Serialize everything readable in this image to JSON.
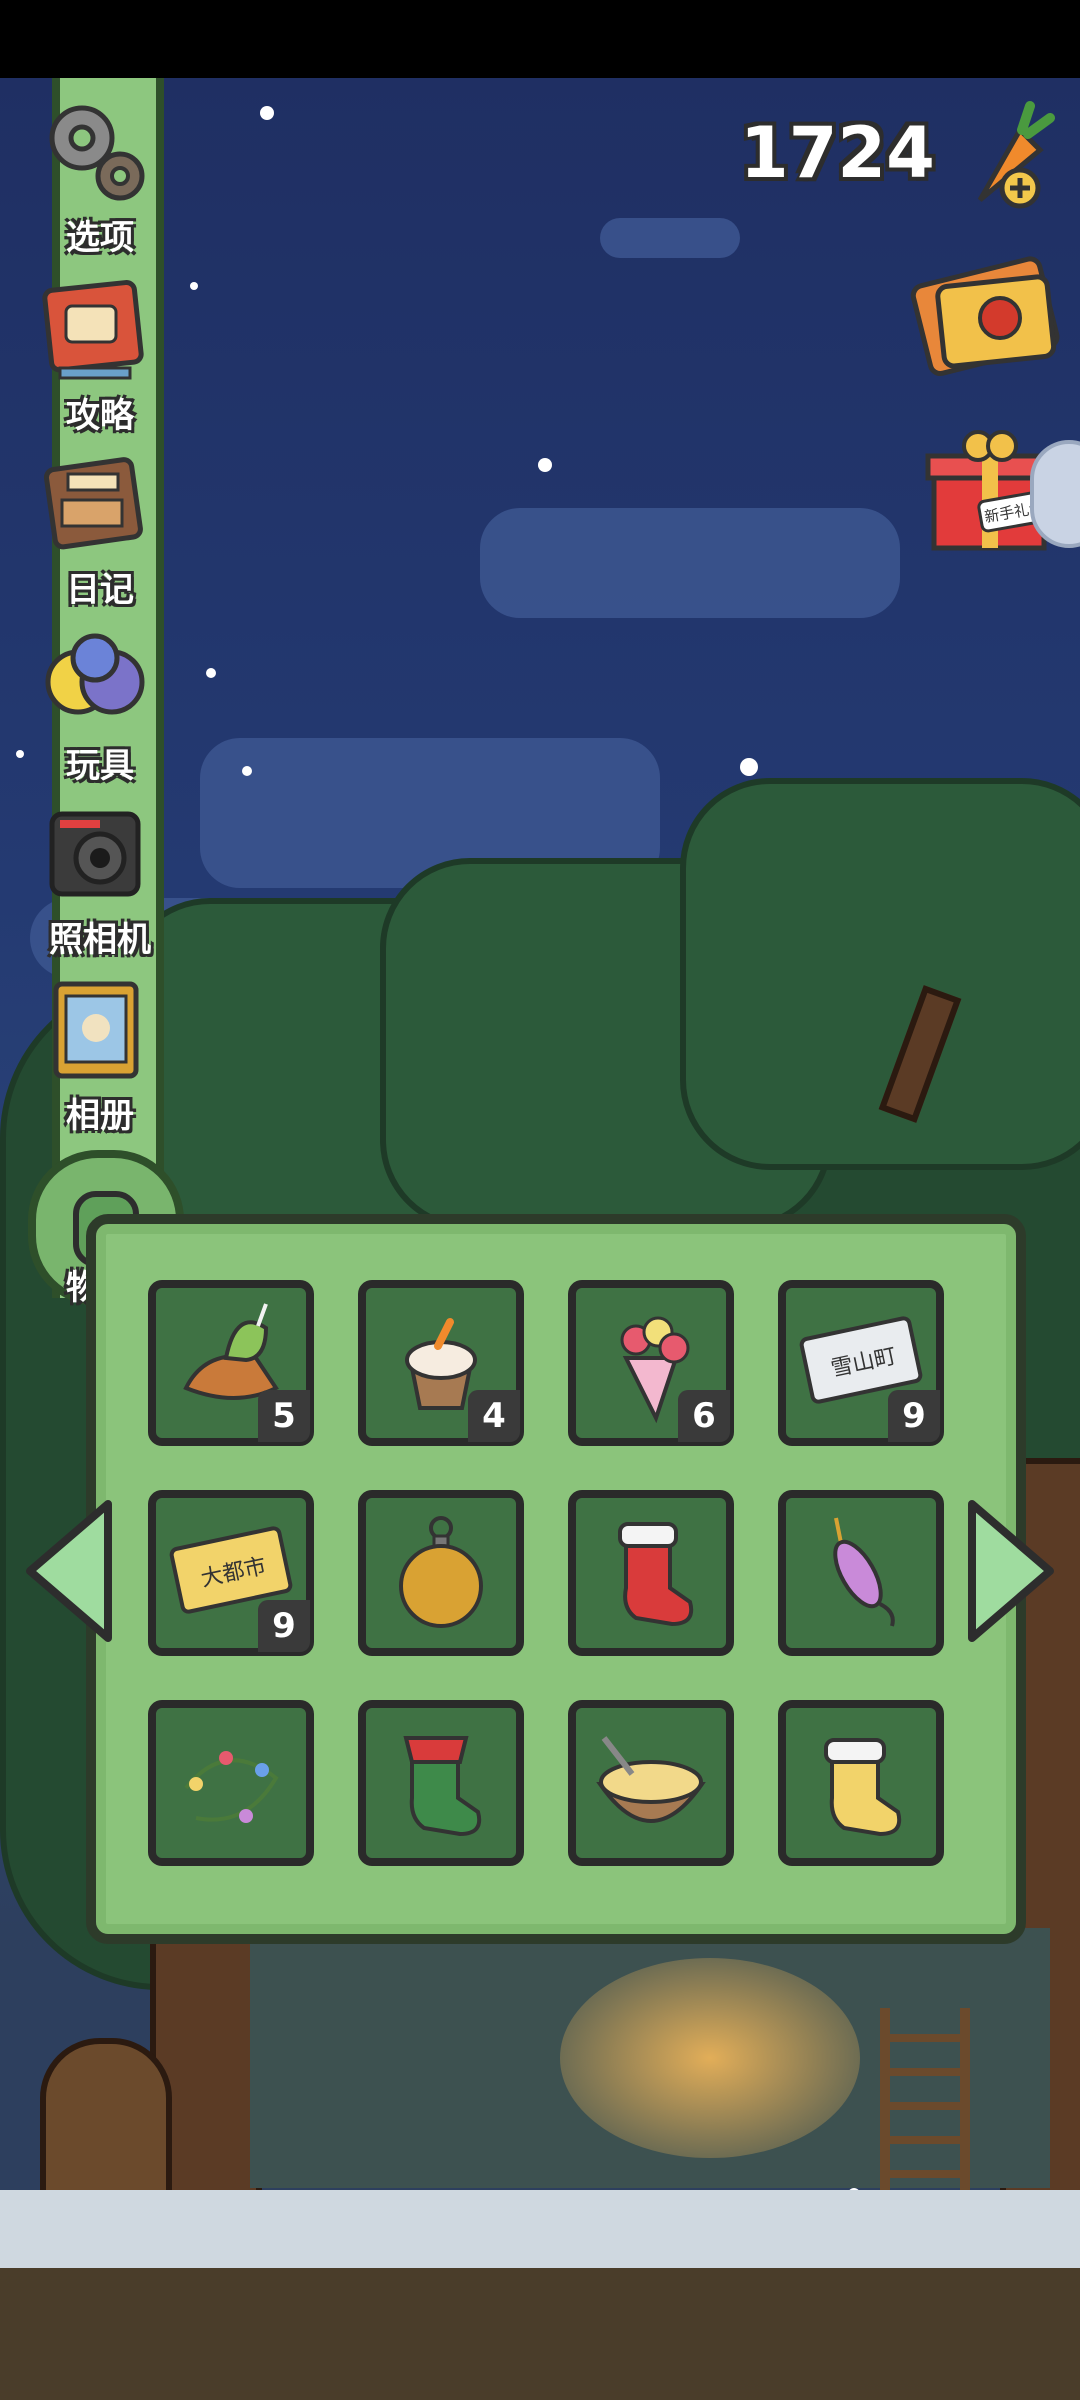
{
  "menu": {
    "items": [
      {
        "label": "选项",
        "icon": "gear-icon"
      },
      {
        "label": "攻略",
        "icon": "guidebook-icon"
      },
      {
        "label": "日记",
        "icon": "diary-icon"
      },
      {
        "label": "玩具",
        "icon": "toys-icon"
      },
      {
        "label": "照相机",
        "icon": "camera-icon"
      },
      {
        "label": "相册",
        "icon": "photo-album-icon"
      },
      {
        "label": "物品",
        "icon": "backpack-icon"
      }
    ]
  },
  "currency": {
    "carrots": "1724",
    "icon": "carrot-plus-icon"
  },
  "shortcuts": {
    "ticket": "lottery-ticket-icon",
    "gift": "gift-box-icon",
    "gift_tag": "新手礼包"
  },
  "inventory": {
    "items": [
      {
        "name": "taiyaki-icecream",
        "count": "5"
      },
      {
        "name": "cupcake",
        "count": "4"
      },
      {
        "name": "flower-bouquet",
        "count": "6"
      },
      {
        "name": "ticket-snow-town",
        "count": "9"
      },
      {
        "name": "ticket-big-city",
        "count": "9"
      },
      {
        "name": "gold-ornament",
        "count": ""
      },
      {
        "name": "red-stocking",
        "count": ""
      },
      {
        "name": "fishing-lure",
        "count": ""
      },
      {
        "name": "string-lights",
        "count": ""
      },
      {
        "name": "green-stocking",
        "count": ""
      },
      {
        "name": "rice-bowl",
        "count": ""
      },
      {
        "name": "yellow-stocking",
        "count": ""
      }
    ],
    "ticket_snow_text": "雪山町",
    "ticket_city_text": "大都市"
  },
  "colors": {
    "panel": "#8bc47b",
    "slot": "#3f7244",
    "sky": "#243a72",
    "rail": "#8dc77f"
  }
}
